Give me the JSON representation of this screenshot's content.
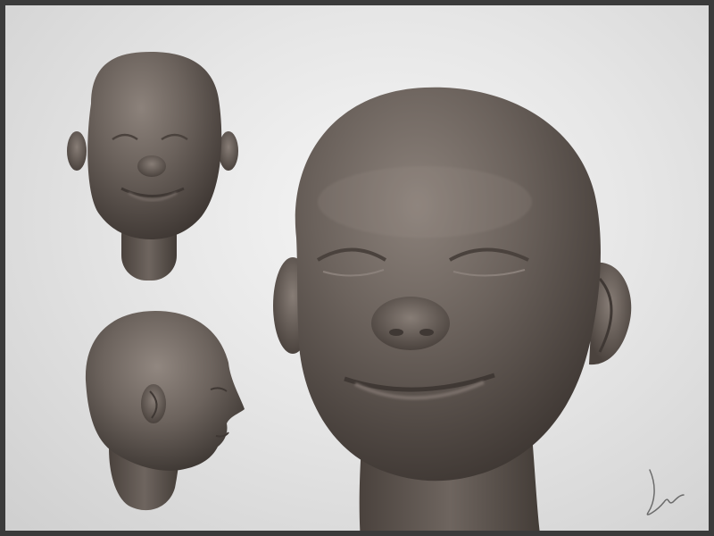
{
  "colors": {
    "frame": "#3b3b3b",
    "background_light": "#f2f2f2",
    "background_dark": "#cfcfcf",
    "skin_highlight": "#8a7f78",
    "skin_mid": "#6a615b",
    "skin_shadow": "#3f3834",
    "signature_stroke": "#6b6b6b"
  },
  "icons": {
    "front_view": "sculpted-head-front-icon",
    "side_view": "sculpted-head-profile-icon",
    "closeup_view": "sculpted-head-closeup-icon",
    "signature": "signature-icon"
  }
}
